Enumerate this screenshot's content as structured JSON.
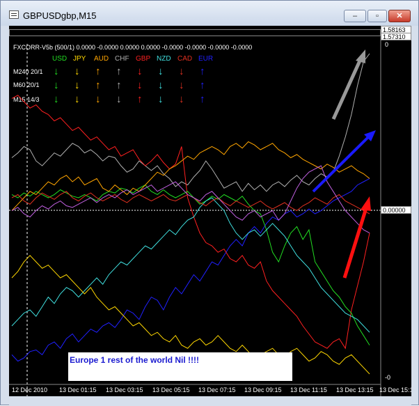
{
  "window": {
    "title": "GBPUSDgbp,M15",
    "minimize_label": "–",
    "restore_label": "▫",
    "close_label": "✕"
  },
  "price": {
    "top_value": "1.58163",
    "second_value": "1.57310",
    "zero_mark": "0.00000"
  },
  "indicator": {
    "header": "FXCORR-V5b (500/1) 0.0000 -0.0000 0.0000 0.0000 -0.0000 -0.0000 -0.0000 -0.0000",
    "scale_top": "0",
    "scale_bottom": "-0",
    "currencies": [
      {
        "name": "USD",
        "color": "#22dd22"
      },
      {
        "name": "JPY",
        "color": "#ffd700"
      },
      {
        "name": "AUD",
        "color": "#ffa500"
      },
      {
        "name": "CHF",
        "color": "#b0b0b0"
      },
      {
        "name": "GBP",
        "color": "#ff2020"
      },
      {
        "name": "NZD",
        "color": "#40e0e0"
      },
      {
        "name": "CAD",
        "color": "#e03020"
      },
      {
        "name": "EUR",
        "color": "#2020ff"
      }
    ],
    "rows": [
      {
        "label": "M240 20/1",
        "arrows": [
          "↓",
          "↓",
          "↑",
          "↑",
          "↓",
          "↓",
          "↓",
          "↑"
        ]
      },
      {
        "label": "M60 20/1",
        "arrows": [
          "↓",
          "↓",
          "↑",
          "↑",
          "↓",
          "↓",
          "↓",
          "↑"
        ]
      },
      {
        "label": "M15 14/3",
        "arrows": [
          "↓",
          "↓",
          "↓",
          "↓",
          "↑",
          "↓",
          "↓",
          "↑"
        ]
      }
    ]
  },
  "time_axis": [
    "12 Dec 2010",
    "13 Dec 01:15",
    "13 Dec 03:15",
    "13 Dec 05:15",
    "13 Dec 07:15",
    "13 Dec 09:15",
    "13 Dec 11:15",
    "13 Dec 13:15",
    "13 Dec 15:15"
  ],
  "note": "Europe 1 rest of the world Nil !!!!",
  "chart_data": {
    "type": "line",
    "x_labels": [
      "12 Dec 2010",
      "13 Dec 01:15",
      "13 Dec 03:15",
      "13 Dec 05:15",
      "13 Dec 07:15",
      "13 Dec 09:15",
      "13 Dec 11:15",
      "13 Dec 13:15",
      "13 Dec 15:15"
    ],
    "series": [
      {
        "name": "CHF",
        "color": "#b0b0b0",
        "values": [
          0.35,
          0.38,
          0.42,
          0.4,
          0.33,
          0.3,
          0.34,
          0.38,
          0.36,
          0.4,
          0.44,
          0.42,
          0.38,
          0.4,
          0.37,
          0.33,
          0.36,
          0.35,
          0.3,
          0.26,
          0.28,
          0.33,
          0.3,
          0.27,
          0.3,
          0.25,
          0.22,
          0.17,
          0.2,
          0.18,
          0.23,
          0.27,
          0.33,
          0.28,
          0.22,
          0.16,
          0.18,
          0.2,
          0.14,
          0.19,
          0.15,
          0.18,
          0.14,
          0.18,
          0.2,
          0.17,
          0.21,
          0.24,
          0.2,
          0.18,
          0.22,
          0.25,
          0.23,
          0.26,
          0.36,
          0.48,
          0.62,
          0.8,
          0.95,
          1.0
        ]
      },
      {
        "name": "EUR",
        "color": "#2020ff",
        "values": [
          -0.88,
          -0.92,
          -0.9,
          -0.86,
          -0.85,
          -0.88,
          -0.82,
          -0.8,
          -0.84,
          -0.78,
          -0.75,
          -0.8,
          -0.76,
          -0.72,
          -0.74,
          -0.7,
          -0.68,
          -0.71,
          -0.66,
          -0.6,
          -0.62,
          -0.66,
          -0.58,
          -0.52,
          -0.54,
          -0.6,
          -0.52,
          -0.46,
          -0.5,
          -0.44,
          -0.38,
          -0.42,
          -0.36,
          -0.3,
          -0.32,
          -0.26,
          -0.2,
          -0.16,
          -0.2,
          -0.12,
          -0.08,
          -0.12,
          -0.06,
          -0.02,
          -0.04,
          0.0,
          0.02,
          -0.02,
          0.0,
          0.03,
          0.0,
          0.02,
          0.05,
          0.08,
          0.1,
          0.12,
          0.14,
          0.18,
          0.2,
          0.22
        ]
      },
      {
        "name": "GBP",
        "color": "#ff2020",
        "values": [
          0.72,
          0.74,
          0.7,
          0.66,
          0.68,
          0.64,
          0.62,
          0.58,
          0.6,
          0.56,
          0.52,
          0.54,
          0.5,
          0.46,
          0.48,
          0.44,
          0.4,
          0.42,
          0.36,
          0.38,
          0.4,
          0.34,
          0.3,
          0.33,
          0.37,
          0.32,
          0.28,
          0.31,
          0.42,
          0.1,
          -0.02,
          -0.12,
          -0.18,
          -0.2,
          -0.24,
          -0.22,
          -0.28,
          -0.3,
          -0.26,
          -0.32,
          -0.34,
          -0.3,
          -0.42,
          -0.48,
          -0.52,
          -0.56,
          -0.6,
          -0.64,
          -0.7,
          -0.75,
          -0.8,
          -0.82,
          -0.84,
          -0.8,
          -0.78,
          -0.84,
          -0.6,
          -0.45,
          -0.3,
          -0.12
        ]
      },
      {
        "name": "USD",
        "color": "#22dd22",
        "values": [
          0.12,
          0.1,
          0.13,
          0.11,
          0.14,
          0.12,
          0.1,
          0.12,
          0.15,
          0.13,
          0.11,
          0.1,
          0.12,
          0.1,
          0.08,
          0.12,
          0.14,
          0.13,
          0.16,
          0.15,
          0.13,
          0.16,
          0.18,
          0.14,
          0.12,
          0.15,
          0.12,
          0.1,
          0.12,
          0.14,
          0.1,
          0.06,
          0.08,
          0.11,
          0.09,
          0.12,
          0.1,
          0.08,
          0.11,
          0.06,
          0.02,
          0.0,
          -0.1,
          -0.24,
          -0.3,
          -0.2,
          -0.12,
          -0.08,
          -0.16,
          -0.1,
          -0.3,
          -0.36,
          -0.42,
          -0.48,
          -0.52,
          -0.58,
          -0.62,
          -0.7,
          -0.76,
          -0.82
        ]
      },
      {
        "name": "AUD",
        "color": "#ffa500",
        "values": [
          0.02,
          0.06,
          0.1,
          0.14,
          0.12,
          0.16,
          0.2,
          0.18,
          0.22,
          0.24,
          0.2,
          0.23,
          0.18,
          0.2,
          0.22,
          0.16,
          0.14,
          0.18,
          0.15,
          0.12,
          0.16,
          0.14,
          0.18,
          0.22,
          0.26,
          0.24,
          0.28,
          0.3,
          0.33,
          0.36,
          0.34,
          0.38,
          0.4,
          0.42,
          0.4,
          0.37,
          0.42,
          0.44,
          0.41,
          0.45,
          0.43,
          0.4,
          0.42,
          0.44,
          0.4,
          0.38,
          0.35,
          0.37,
          0.34,
          0.32,
          0.3,
          0.28,
          0.31,
          0.29,
          0.26,
          0.28,
          0.3,
          0.27,
          0.25,
          0.22
        ]
      },
      {
        "name": "NZD",
        "color": "#40e0e0",
        "values": [
          -0.7,
          -0.66,
          -0.62,
          -0.6,
          -0.64,
          -0.58,
          -0.52,
          -0.56,
          -0.5,
          -0.46,
          -0.48,
          -0.52,
          -0.48,
          -0.44,
          -0.4,
          -0.44,
          -0.38,
          -0.34,
          -0.3,
          -0.32,
          -0.28,
          -0.24,
          -0.2,
          -0.22,
          -0.18,
          -0.14,
          -0.1,
          -0.13,
          -0.08,
          -0.04,
          -0.02,
          0.04,
          0.08,
          0.1,
          0.06,
          0.02,
          -0.06,
          -0.12,
          -0.16,
          -0.12,
          -0.1,
          -0.14,
          -0.1,
          -0.06,
          -0.1,
          -0.14,
          -0.2,
          -0.26,
          -0.3,
          -0.34,
          -0.4,
          -0.46,
          -0.5,
          -0.54,
          -0.58,
          -0.62,
          -0.64,
          -0.66,
          -0.7,
          -0.74
        ]
      },
      {
        "name": "JPY",
        "color": "#ffd700",
        "values": [
          -0.4,
          -0.36,
          -0.3,
          -0.26,
          -0.3,
          -0.34,
          -0.32,
          -0.36,
          -0.4,
          -0.38,
          -0.42,
          -0.46,
          -0.5,
          -0.46,
          -0.52,
          -0.56,
          -0.6,
          -0.58,
          -0.62,
          -0.66,
          -0.7,
          -0.68,
          -0.72,
          -0.76,
          -0.74,
          -0.78,
          -0.8,
          -0.76,
          -0.82,
          -0.84,
          -0.8,
          -0.78,
          -0.82,
          -0.8,
          -0.76,
          -0.8,
          -0.84,
          -0.86,
          -0.82,
          -0.86,
          -0.9,
          -0.88,
          -0.86,
          -0.84,
          -0.88,
          -0.9,
          -0.86,
          -0.84,
          -0.88,
          -0.92,
          -0.9,
          -0.86,
          -0.88,
          -0.92,
          -0.94,
          -0.9,
          -0.88,
          -0.92,
          -0.96,
          -1.0
        ]
      },
      {
        "name": "CAD",
        "color": "#e03020",
        "values": [
          0.1,
          0.12,
          0.08,
          0.06,
          0.1,
          0.13,
          0.11,
          0.09,
          0.12,
          0.14,
          0.1,
          0.08,
          0.11,
          0.13,
          0.1,
          0.08,
          0.1,
          0.12,
          0.09,
          0.07,
          0.1,
          0.12,
          0.1,
          0.08,
          0.1,
          0.12,
          0.09,
          0.08,
          0.1,
          0.12,
          0.1,
          0.07,
          0.05,
          0.08,
          0.1,
          0.07,
          0.05,
          0.08,
          0.06,
          0.04,
          0.06,
          0.08,
          0.05,
          0.03,
          0.05,
          0.07,
          0.04,
          0.02,
          0.05,
          0.07,
          0.1,
          0.08,
          0.06,
          0.1,
          0.12,
          0.08,
          0.06,
          0.04,
          0.02,
          0.0
        ]
      },
      {
        "name": "PURPLE",
        "color": "#c060e0",
        "values": [
          0.02,
          0.04,
          0.0,
          -0.02,
          0.02,
          0.05,
          0.03,
          0.06,
          0.08,
          0.05,
          0.04,
          0.06,
          0.08,
          0.1,
          0.07,
          0.1,
          0.12,
          0.1,
          0.13,
          0.15,
          0.12,
          0.14,
          0.16,
          0.18,
          0.14,
          0.16,
          0.18,
          0.2,
          0.16,
          0.12,
          0.1,
          0.08,
          0.12,
          0.14,
          0.1,
          0.06,
          0.02,
          -0.02,
          -0.04,
          0.0,
          0.02,
          -0.02,
          0.0,
          0.02,
          -0.04,
          0.0,
          0.08,
          0.16,
          0.22,
          0.26,
          0.28,
          0.3,
          0.2,
          0.14,
          0.08,
          0.02,
          -0.02,
          -0.06,
          -0.1,
          -0.12
        ]
      }
    ],
    "ylim": [
      -1.0,
      1.0
    ],
    "grid": false,
    "legend": "top-left"
  }
}
